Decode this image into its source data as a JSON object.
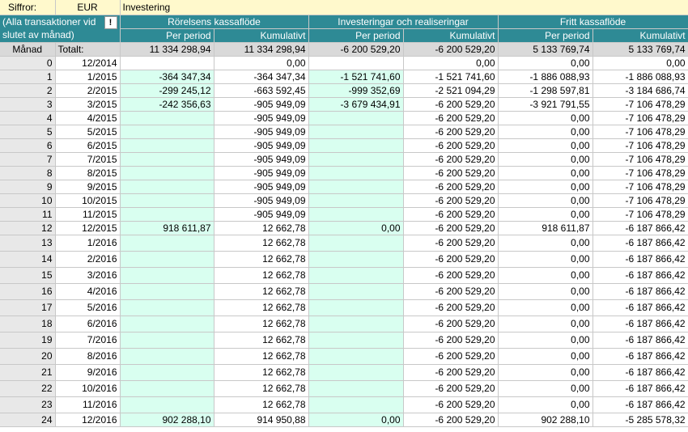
{
  "header": {
    "figures_label": "Siffror:",
    "currency": "EUR",
    "title": "Investering"
  },
  "left_note": "(Alla transaktioner vid slutet av månad)",
  "note_icon": "exclamation-icon",
  "note_icon_glyph": "!",
  "groups": {
    "operating": "Rörelsens kassaflöde",
    "investing": "Investeringar och realiseringar",
    "free": "Fritt kassaflöde"
  },
  "subheaders": {
    "per_period": "Per period",
    "cumulative": "Kumulativt"
  },
  "totals": {
    "month_label": "Månad",
    "total_label": "Totalt:",
    "values": [
      "11 334 298,94",
      "11 334 298,94",
      "-6 200 529,20",
      "-6 200 529,20",
      "5 133 769,74",
      "5 133 769,74"
    ]
  },
  "rows": [
    {
      "n": "0",
      "m": "12/2014",
      "v": [
        "",
        "0,00",
        "",
        "0,00",
        "0,00",
        "0,00"
      ]
    },
    {
      "n": "1",
      "m": "1/2015",
      "v": [
        "-364 347,34",
        "-364 347,34",
        "-1 521 741,60",
        "-1 521 741,60",
        "-1 886 088,93",
        "-1 886 088,93"
      ]
    },
    {
      "n": "2",
      "m": "2/2015",
      "v": [
        "-299 245,12",
        "-663 592,45",
        "-999 352,69",
        "-2 521 094,29",
        "-1 298 597,81",
        "-3 184 686,74"
      ]
    },
    {
      "n": "3",
      "m": "3/2015",
      "v": [
        "-242 356,63",
        "-905 949,09",
        "-3 679 434,91",
        "-6 200 529,20",
        "-3 921 791,55",
        "-7 106 478,29"
      ]
    },
    {
      "n": "4",
      "m": "4/2015",
      "v": [
        "",
        "-905 949,09",
        "",
        "-6 200 529,20",
        "0,00",
        "-7 106 478,29"
      ]
    },
    {
      "n": "5",
      "m": "5/2015",
      "v": [
        "",
        "-905 949,09",
        "",
        "-6 200 529,20",
        "0,00",
        "-7 106 478,29"
      ]
    },
    {
      "n": "6",
      "m": "6/2015",
      "v": [
        "",
        "-905 949,09",
        "",
        "-6 200 529,20",
        "0,00",
        "-7 106 478,29"
      ]
    },
    {
      "n": "7",
      "m": "7/2015",
      "v": [
        "",
        "-905 949,09",
        "",
        "-6 200 529,20",
        "0,00",
        "-7 106 478,29"
      ]
    },
    {
      "n": "8",
      "m": "8/2015",
      "v": [
        "",
        "-905 949,09",
        "",
        "-6 200 529,20",
        "0,00",
        "-7 106 478,29"
      ]
    },
    {
      "n": "9",
      "m": "9/2015",
      "v": [
        "",
        "-905 949,09",
        "",
        "-6 200 529,20",
        "0,00",
        "-7 106 478,29"
      ]
    },
    {
      "n": "10",
      "m": "10/2015",
      "v": [
        "",
        "-905 949,09",
        "",
        "-6 200 529,20",
        "0,00",
        "-7 106 478,29"
      ]
    },
    {
      "n": "11",
      "m": "11/2015",
      "v": [
        "",
        "-905 949,09",
        "",
        "-6 200 529,20",
        "0,00",
        "-7 106 478,29"
      ]
    },
    {
      "n": "12",
      "m": "12/2015",
      "v": [
        "918 611,87",
        "12 662,78",
        "0,00",
        "-6 200 529,20",
        "918 611,87",
        "-6 187 866,42"
      ]
    },
    {
      "n": "13",
      "m": "1/2016",
      "v": [
        "",
        "12 662,78",
        "",
        "-6 200 529,20",
        "0,00",
        "-6 187 866,42"
      ]
    },
    {
      "n": "14",
      "m": "2/2016",
      "v": [
        "",
        "12 662,78",
        "",
        "-6 200 529,20",
        "0,00",
        "-6 187 866,42"
      ]
    },
    {
      "n": "15",
      "m": "3/2016",
      "v": [
        "",
        "12 662,78",
        "",
        "-6 200 529,20",
        "0,00",
        "-6 187 866,42"
      ]
    },
    {
      "n": "16",
      "m": "4/2016",
      "v": [
        "",
        "12 662,78",
        "",
        "-6 200 529,20",
        "0,00",
        "-6 187 866,42"
      ]
    },
    {
      "n": "17",
      "m": "5/2016",
      "v": [
        "",
        "12 662,78",
        "",
        "-6 200 529,20",
        "0,00",
        "-6 187 866,42"
      ]
    },
    {
      "n": "18",
      "m": "6/2016",
      "v": [
        "",
        "12 662,78",
        "",
        "-6 200 529,20",
        "0,00",
        "-6 187 866,42"
      ]
    },
    {
      "n": "19",
      "m": "7/2016",
      "v": [
        "",
        "12 662,78",
        "",
        "-6 200 529,20",
        "0,00",
        "-6 187 866,42"
      ]
    },
    {
      "n": "20",
      "m": "8/2016",
      "v": [
        "",
        "12 662,78",
        "",
        "-6 200 529,20",
        "0,00",
        "-6 187 866,42"
      ]
    },
    {
      "n": "21",
      "m": "9/2016",
      "v": [
        "",
        "12 662,78",
        "",
        "-6 200 529,20",
        "0,00",
        "-6 187 866,42"
      ]
    },
    {
      "n": "22",
      "m": "10/2016",
      "v": [
        "",
        "12 662,78",
        "",
        "-6 200 529,20",
        "0,00",
        "-6 187 866,42"
      ]
    },
    {
      "n": "23",
      "m": "11/2016",
      "v": [
        "",
        "12 662,78",
        "",
        "-6 200 529,20",
        "0,00",
        "-6 187 866,42"
      ]
    },
    {
      "n": "24",
      "m": "12/2016",
      "v": [
        "902 288,10",
        "914 950,88",
        "0,00",
        "-6 200 529,20",
        "902 288,10",
        "-5 285 578,32"
      ]
    }
  ],
  "colors": {
    "header_teal": "#2e8a95",
    "header_yellow": "#fff9cc",
    "input_mint": "#d9fff0",
    "totals_gray": "#d9d9d9"
  }
}
